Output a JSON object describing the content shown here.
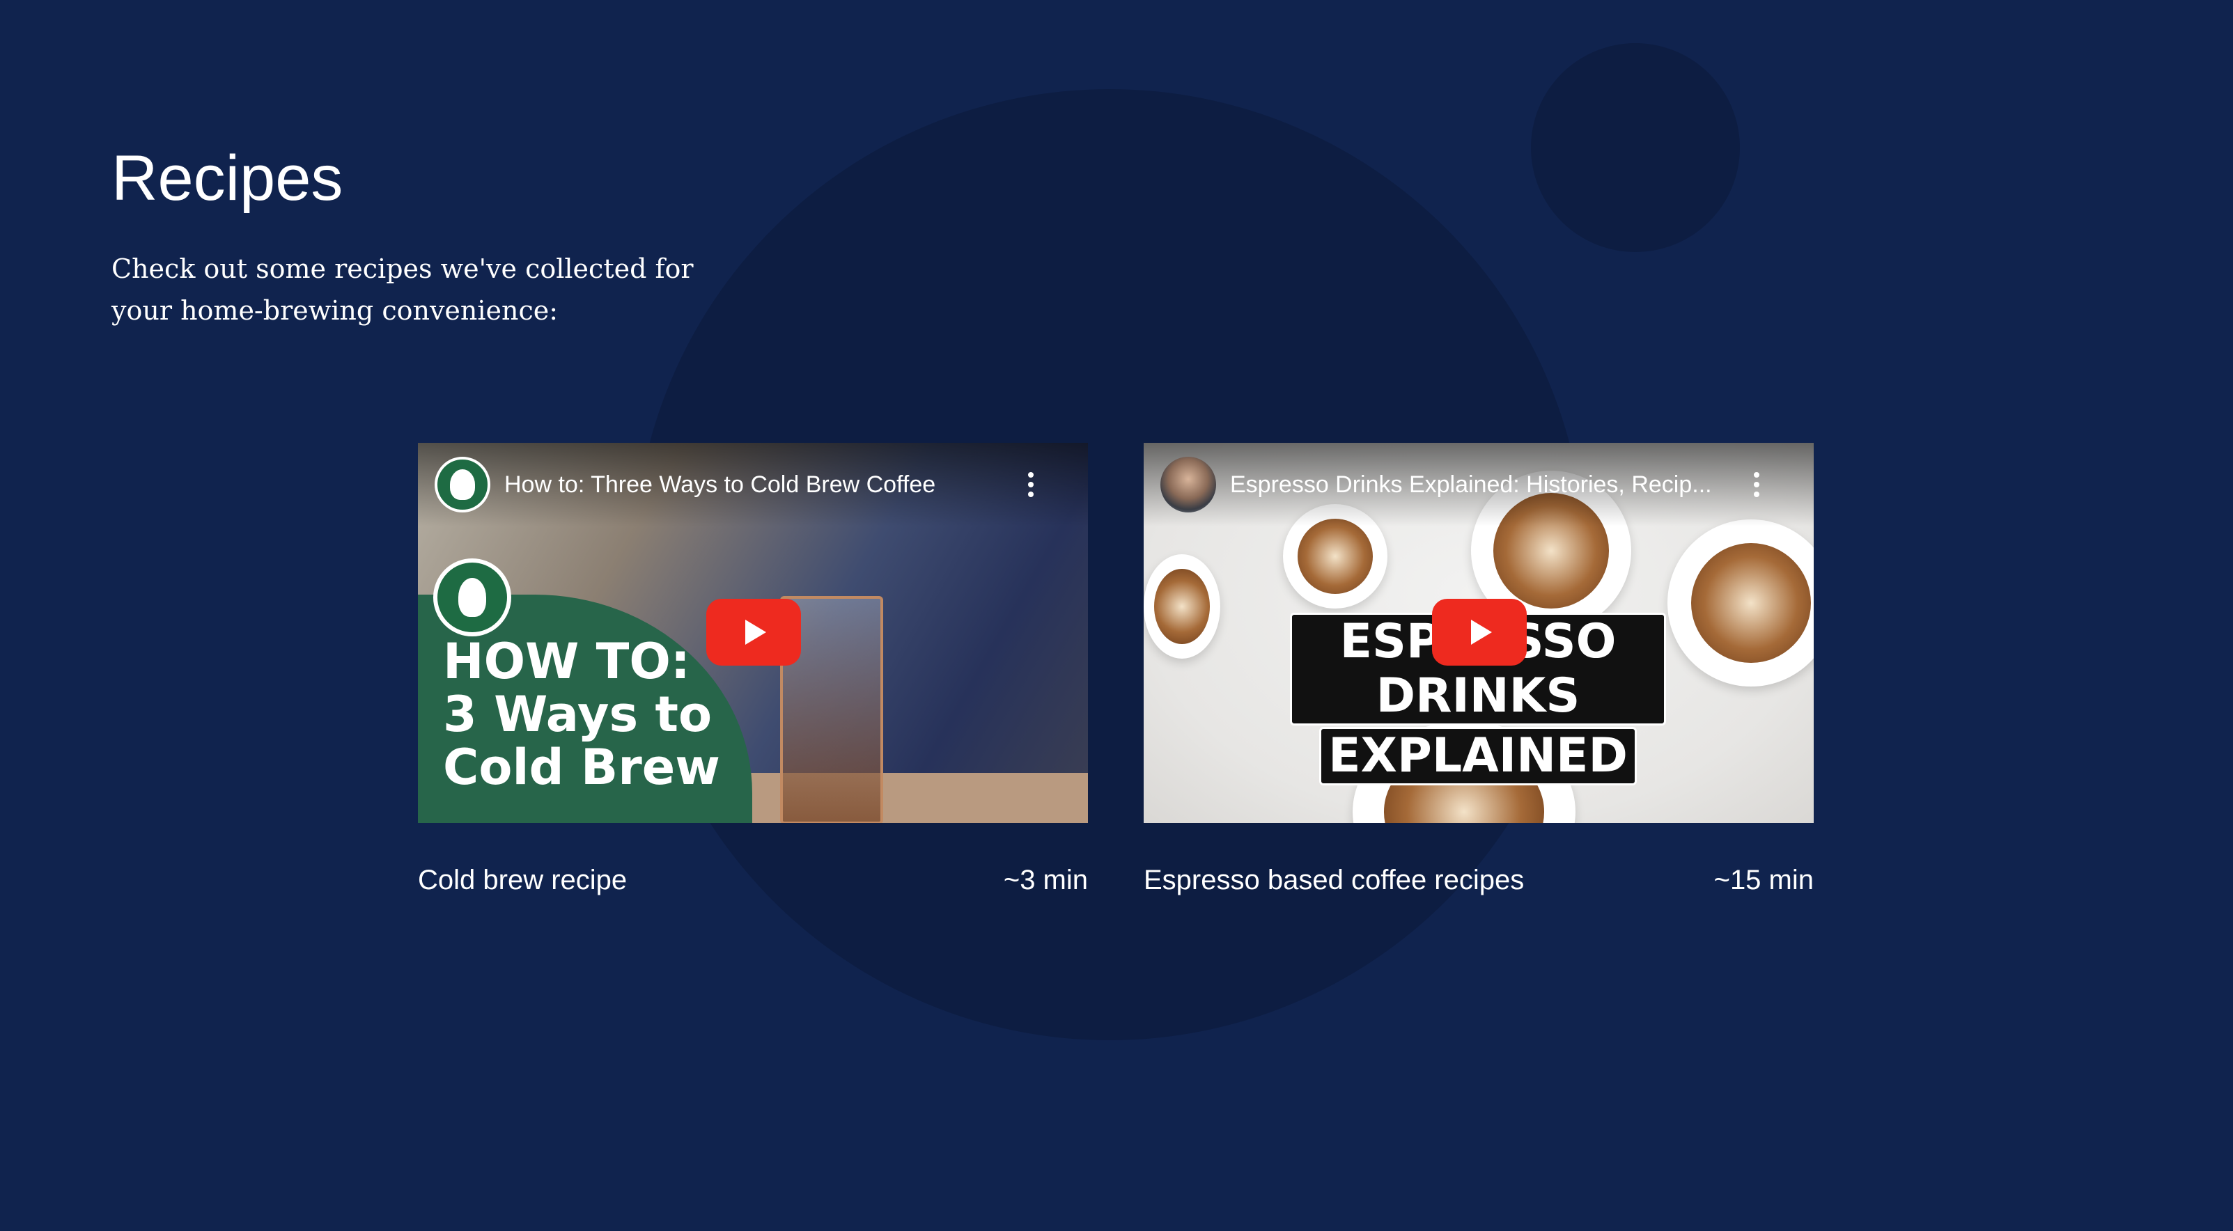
{
  "page": {
    "title": "Recipes",
    "intro": "Check out some recipes we've collected for your home-brewing convenience:"
  },
  "colors": {
    "background": "#10234e",
    "decor_circle": "#0d1d42",
    "text": "#ffffff",
    "youtube_red": "#ee2a1f",
    "starbucks_green": "#27654a"
  },
  "videos": [
    {
      "channel_icon": "starbucks-logo-icon",
      "video_title": "How to: Three Ways to Cold Brew Coffee",
      "thumbnail_text": "HOW TO:\n3 Ways to\nCold Brew",
      "name": "Cold brew recipe",
      "duration": "~3 min"
    },
    {
      "channel_icon": "channel-avatar-icon",
      "video_title": "Espresso Drinks Explained: Histories, Recip...",
      "thumbnail_text": [
        "ESPRESSO DRINKS",
        "EXPLAINED"
      ],
      "name": "Espresso based coffee recipes",
      "duration": "~15 min"
    }
  ]
}
